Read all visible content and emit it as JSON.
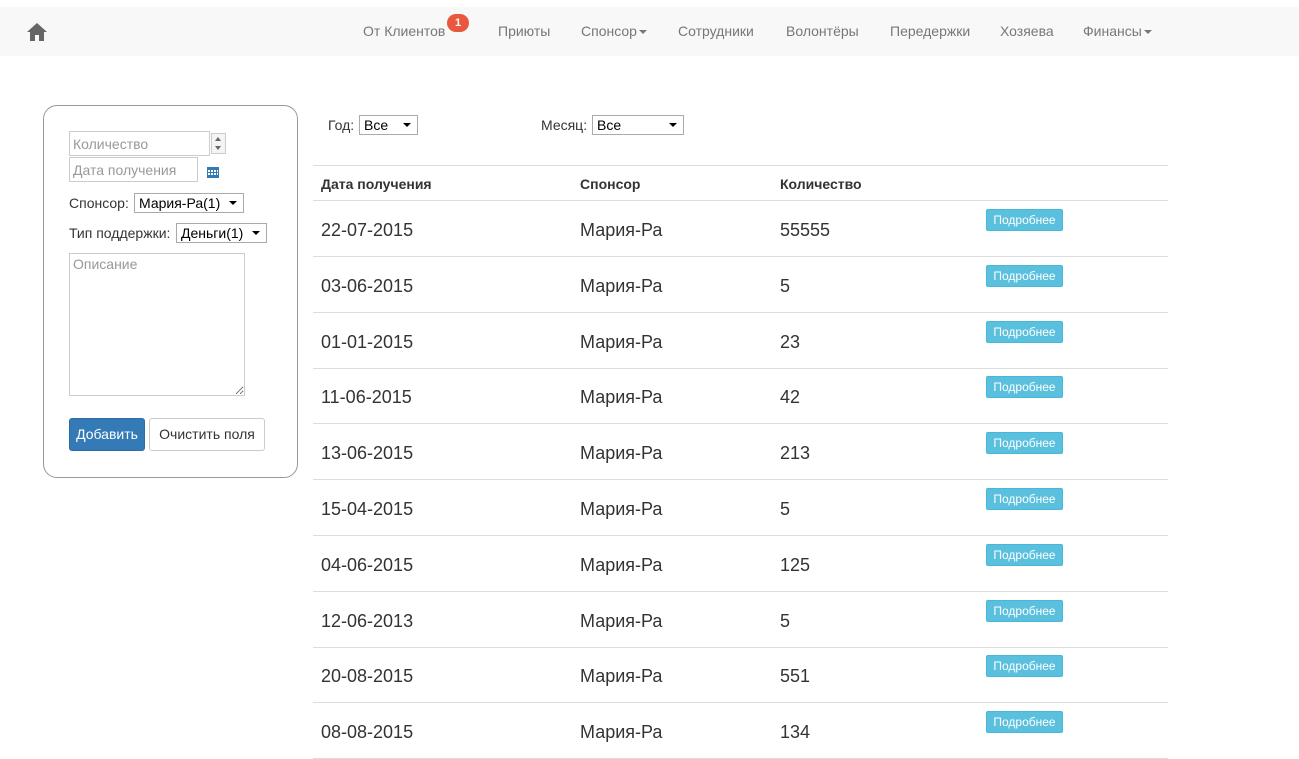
{
  "navbar": {
    "home_icon": "home-icon",
    "items": [
      {
        "label": "От Клиентов",
        "badge": "1",
        "dropdown": false
      },
      {
        "label": "Приюты",
        "dropdown": false
      },
      {
        "label": "Спонсор",
        "dropdown": true
      },
      {
        "label": "Сотрудники",
        "dropdown": false
      },
      {
        "label": "Волонтёры",
        "dropdown": false
      },
      {
        "label": "Передержки",
        "dropdown": false
      },
      {
        "label": "Хозяева",
        "dropdown": false
      },
      {
        "label": "Финансы",
        "dropdown": true
      }
    ]
  },
  "form": {
    "quantity_placeholder": "Количество",
    "date_placeholder": "Дата получения",
    "calendar_icon": "calendar-icon",
    "sponsor_label": "Спонсор:",
    "sponsor_value": "Мария-Ра(1)",
    "support_type_label": "Тип поддержки:",
    "support_type_value": "Деньги(1)",
    "description_placeholder": "Описание",
    "add_button": "Добавить",
    "clear_button": "Очистить поля"
  },
  "filters": {
    "year_label": "Год:",
    "year_value": "Все",
    "month_label": "Месяц:",
    "month_value": "Все"
  },
  "table": {
    "headers": [
      "Дата получения",
      "Спонсор",
      "Количество"
    ],
    "details_label": "Подробнее",
    "rows": [
      {
        "date": "22-07-2015",
        "sponsor": "Мария-Ра",
        "amount": "55555"
      },
      {
        "date": "03-06-2015",
        "sponsor": "Мария-Ра",
        "amount": "5"
      },
      {
        "date": "01-01-2015",
        "sponsor": "Мария-Ра",
        "amount": "23"
      },
      {
        "date": "11-06-2015",
        "sponsor": "Мария-Ра",
        "amount": "42"
      },
      {
        "date": "13-06-2015",
        "sponsor": "Мария-Ра",
        "amount": "213"
      },
      {
        "date": "15-04-2015",
        "sponsor": "Мария-Ра",
        "amount": "5"
      },
      {
        "date": "04-06-2015",
        "sponsor": "Мария-Ра",
        "amount": "125"
      },
      {
        "date": "12-06-2013",
        "sponsor": "Мария-Ра",
        "amount": "5"
      },
      {
        "date": "20-08-2015",
        "sponsor": "Мария-Ра",
        "amount": "551"
      },
      {
        "date": "08-08-2015",
        "sponsor": "Мария-Ра",
        "amount": "134"
      }
    ]
  }
}
